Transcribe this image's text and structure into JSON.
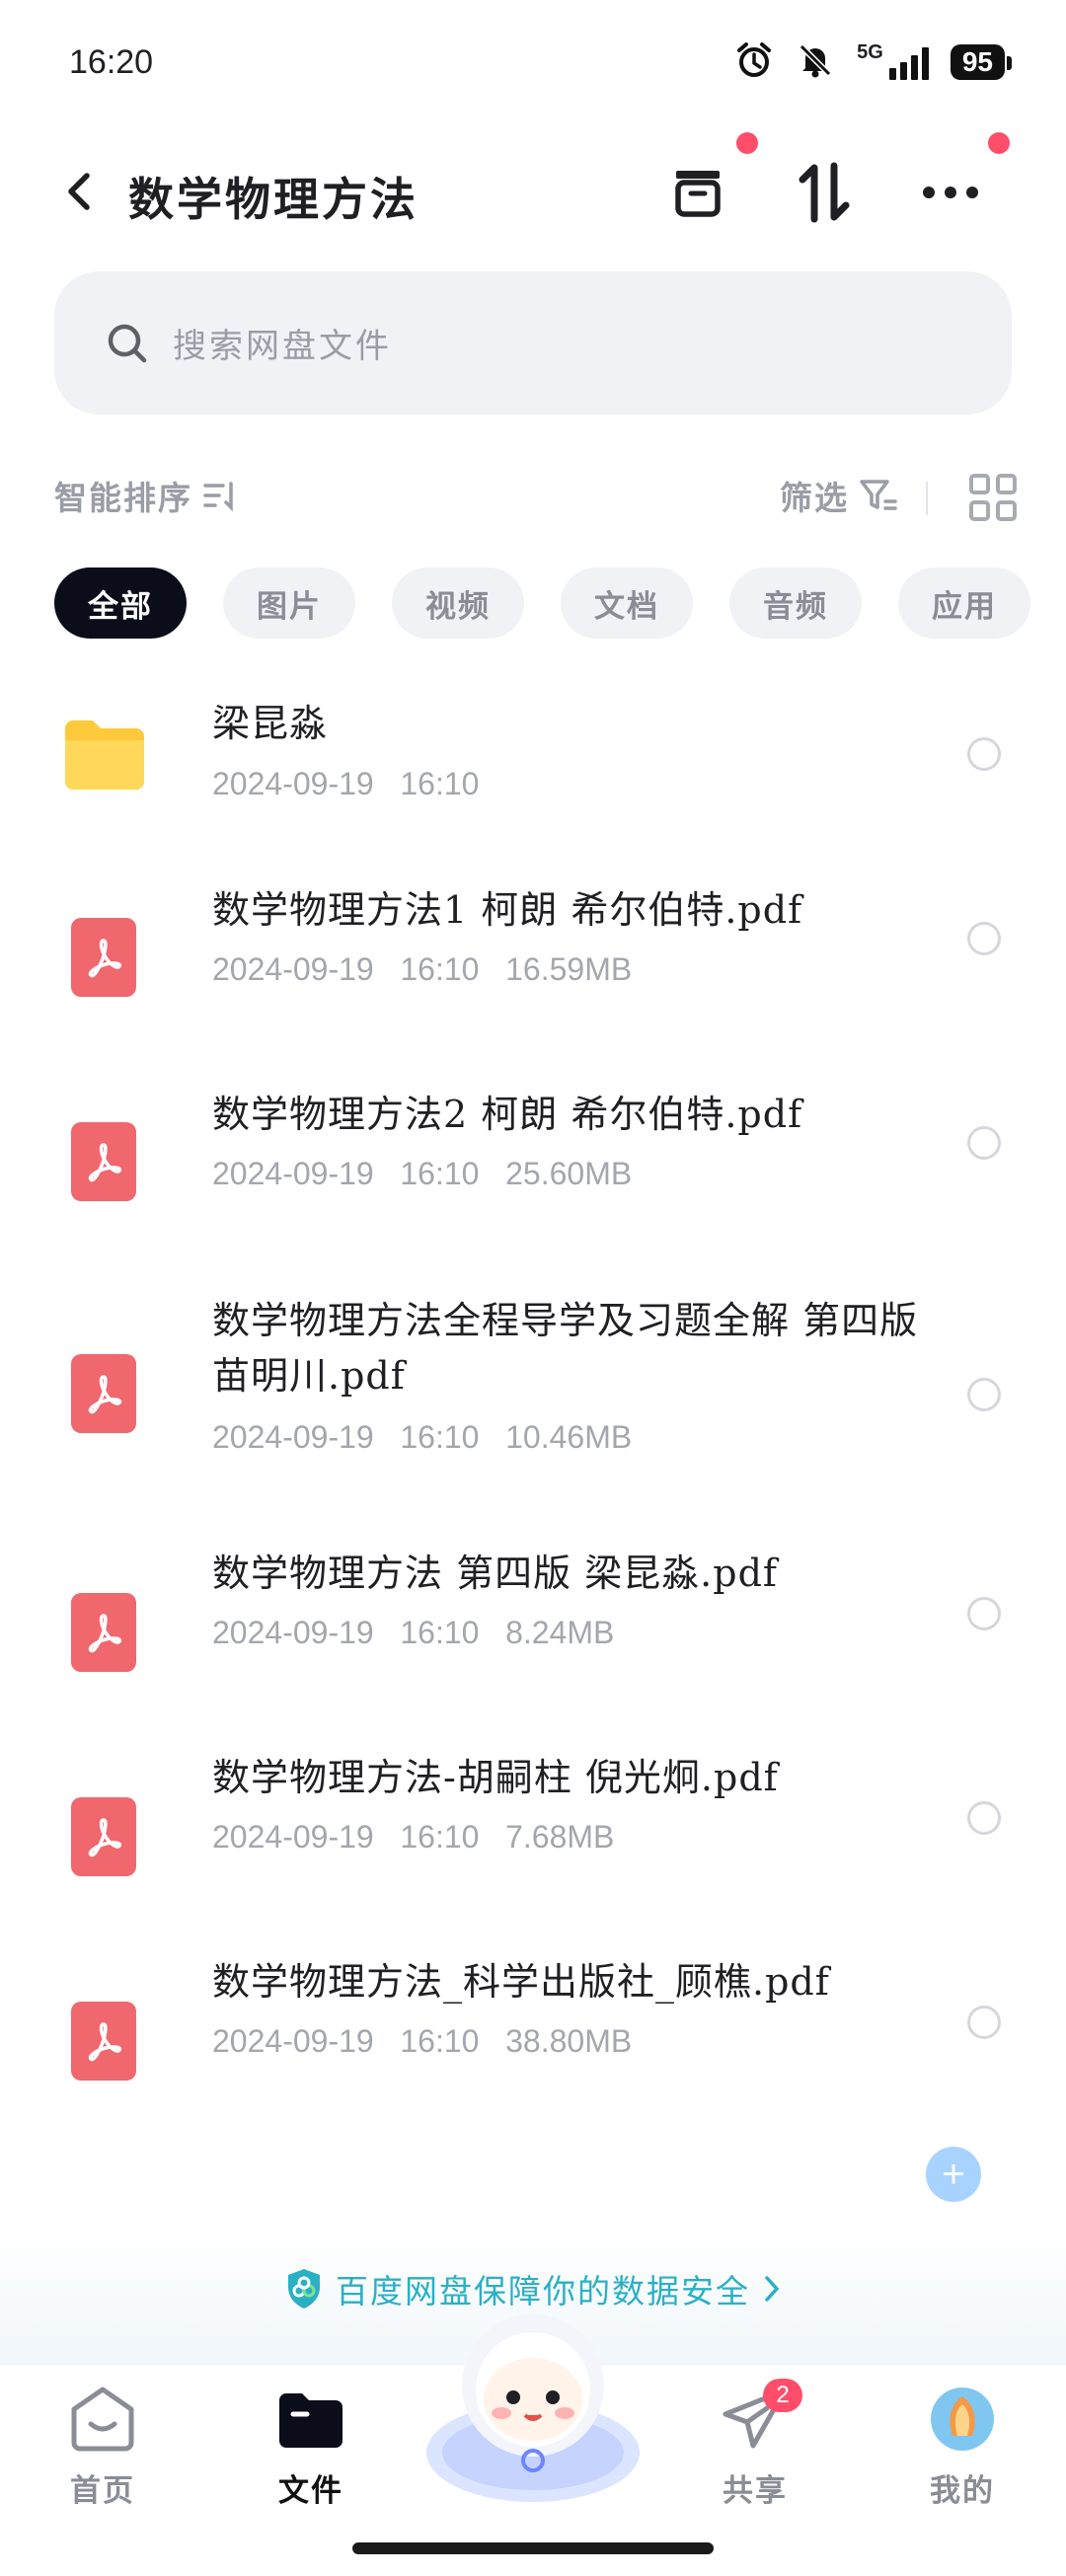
{
  "status_bar": {
    "time": "16:20",
    "network": "5G",
    "battery": "95",
    "icons": [
      "alarm-icon",
      "mute-bell-icon",
      "signal-icon",
      "battery-icon"
    ]
  },
  "header": {
    "title": "数学物理方法",
    "icons": [
      "back-icon",
      "archive-icon",
      "sort-arrows-icon",
      "more-icon"
    ]
  },
  "search": {
    "placeholder": "搜索网盘文件"
  },
  "sortbar": {
    "sort_label": "智能排序",
    "filter_label": "筛选"
  },
  "tabs": [
    {
      "label": "全部",
      "active": true
    },
    {
      "label": "图片",
      "active": false
    },
    {
      "label": "视频",
      "active": false
    },
    {
      "label": "文档",
      "active": false
    },
    {
      "label": "音频",
      "active": false
    },
    {
      "label": "应用",
      "active": false
    }
  ],
  "files": [
    {
      "type": "folder",
      "name": "梁昆淼",
      "meta": "2024-09-19   16:10"
    },
    {
      "type": "pdf",
      "name": "数学物理方法1 柯朗 希尔伯特.pdf",
      "meta": "2024-09-19   16:10   16.59MB"
    },
    {
      "type": "pdf",
      "name": "数学物理方法2 柯朗 希尔伯特.pdf",
      "meta": "2024-09-19   16:10   25.60MB"
    },
    {
      "type": "pdf",
      "name": "数学物理方法全程导学及习题全解 第四版 苗明川.pdf",
      "meta": "2024-09-19   16:10   10.46MB"
    },
    {
      "type": "pdf",
      "name": "数学物理方法 第四版 梁昆淼.pdf",
      "meta": "2024-09-19   16:10   8.24MB"
    },
    {
      "type": "pdf",
      "name": "数学物理方法-胡嗣柱 倪光炯.pdf",
      "meta": "2024-09-19   16:10   7.68MB"
    },
    {
      "type": "pdf",
      "name": "数学物理方法_科学出版社_顾樵.pdf",
      "meta": "2024-09-19   16:10   38.80MB"
    }
  ],
  "banner": {
    "text": "百度网盘保障你的数据安全"
  },
  "bottom_nav": [
    {
      "label": "首页",
      "icon": "home-icon",
      "active": false
    },
    {
      "label": "文件",
      "icon": "folder-icon",
      "active": true
    },
    {
      "label": "共享",
      "icon": "paper-plane-icon",
      "active": false,
      "badge": "2"
    },
    {
      "label": "我的",
      "icon": "avatar",
      "active": false
    }
  ],
  "colors": {
    "accent_pdf": "#f0676e",
    "folder": "#ffc93c",
    "badge": "#ff4d6a",
    "banner_text": "#2ab0c5",
    "active_tab": "#0b0d1a"
  }
}
